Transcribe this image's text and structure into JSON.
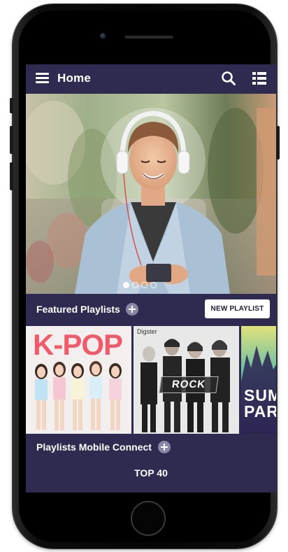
{
  "app_bar": {
    "title": "Home",
    "icons": [
      "menu-icon",
      "search-icon",
      "list-view-icon"
    ]
  },
  "hero": {
    "carousel_dot_count": 4,
    "active_dot_index": 0
  },
  "featured": {
    "title": "Featured Playlists",
    "new_playlist_label": "NEW PLAYLIST"
  },
  "playlists": [
    {
      "cover_text": "K-POP",
      "cover_color": "#f05a6a"
    },
    {
      "brand": "Digster",
      "cover_text": "ROCK"
    },
    {
      "cover_text_lines": [
        "SUM",
        "PAR"
      ]
    }
  ],
  "mobile_connect": {
    "title": "Playlists Mobile Connect"
  },
  "charts": {
    "label": "TOP 40"
  },
  "colors": {
    "app_background": "#2f2a4f",
    "button_background": "#ffffff",
    "plus_icon": "#8a86a8",
    "kpop_title": "#f05a6a"
  }
}
